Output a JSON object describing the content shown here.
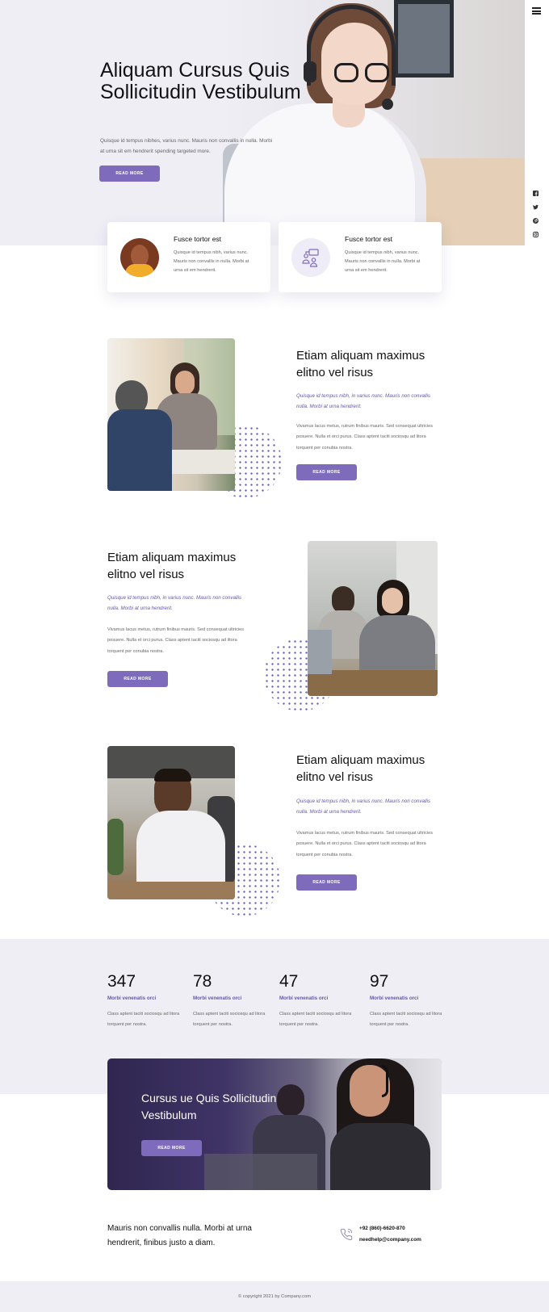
{
  "nav": {
    "menu_icon": "hamburger-menu-icon"
  },
  "social": [
    "facebook-icon",
    "twitter-icon",
    "pinterest-icon",
    "instagram-icon"
  ],
  "hero": {
    "title": "Aliquam Cursus Quis Sollicitudin Vestibulum",
    "text": "Quisque id tempus nibhes, varius nunc. Mauris non convallis in nulla. Morbi at urna sit em hendrerit spending targeted more.",
    "button": "READ MORE"
  },
  "features": [
    {
      "title": "Fusce tortor est",
      "text": "Quisque id tempus nibh, varius nunc. Mauris non convallis in nulla. Morbi at urna sit em hendrerit."
    },
    {
      "title": "Fusce tortor est",
      "text": "Quisque id tempus nibh, varius nunc. Mauris non convallis in nulla. Morbi at urna sit em hendrerit."
    }
  ],
  "sections": [
    {
      "title": "Etiam aliquam maximus elitno vel risus",
      "subtitle": "Quisque id tempus nibh, in varius nunc. Mauris non convallis nulla. Morbi at urna hendrerit.",
      "text": "Vivamus lacus metus, rutrum finibus mauris. Sed consequat ultricies posuere. Nulla et orci purus. Class aptent taciti sociosqu ad litora torquent per conubia nostra.",
      "button": "READ MORE"
    },
    {
      "title": "Etiam aliquam maximus elitno vel risus",
      "subtitle": "Quisque id tempus nibh, in varius nunc. Mauris non convallis nulla. Morbi at urna hendrerit.",
      "text": "Vivamus lacus metus, rutrum finibus mauris. Sed consequat ultricies posuere. Nulla et orci purus. Class aptent taciti sociosqu ad litora torquent per conubia nostra.",
      "button": "READ MORE"
    },
    {
      "title": "Etiam aliquam maximus elitno vel risus",
      "subtitle": "Quisque id tempus nibh, in varius nunc. Mauris non convallis nulla. Morbi at urna hendrerit.",
      "text": "Vivamus lacus metus, rutrum finibus mauris. Sed consequat ultricies posuere. Nulla et orci purus. Class aptent taciti sociosqu ad litora torquent per conubia nostra.",
      "button": "READ MORE"
    }
  ],
  "stats": [
    {
      "number": "347",
      "label": "Morbi venenatis orci",
      "text": "Class aptent taciti sociosqu ad litora torquent per nostra."
    },
    {
      "number": "78",
      "label": "Morbi venenatis orci",
      "text": "Class aptent taciti sociosqu ad litora torquent per nostra."
    },
    {
      "number": "47",
      "label": "Morbi venenatis orci",
      "text": "Class aptent taciti sociosqu ad litora torquent per nostra."
    },
    {
      "number": "97",
      "label": "Morbi venenatis orci",
      "text": "Class aptent taciti sociosqu ad litora torquent per nostra."
    }
  ],
  "banner": {
    "title": "Cursus ue Quis Sollicitudin Vestibulum",
    "button": "READ MORE"
  },
  "contact": {
    "text": "Mauris non convallis nulla. Morbi at urna hendrerit, finibus justo a diam.",
    "phone": "+92 (860)-6620-870",
    "email": "needhelp@company.com",
    "phone_icon": "phone-icon"
  },
  "footer": {
    "copyright": "© copyright 2021 by Company.com"
  },
  "colors": {
    "accent": "#7e6bbb",
    "accent_text": "#6655b3",
    "band": "#efeef5"
  }
}
